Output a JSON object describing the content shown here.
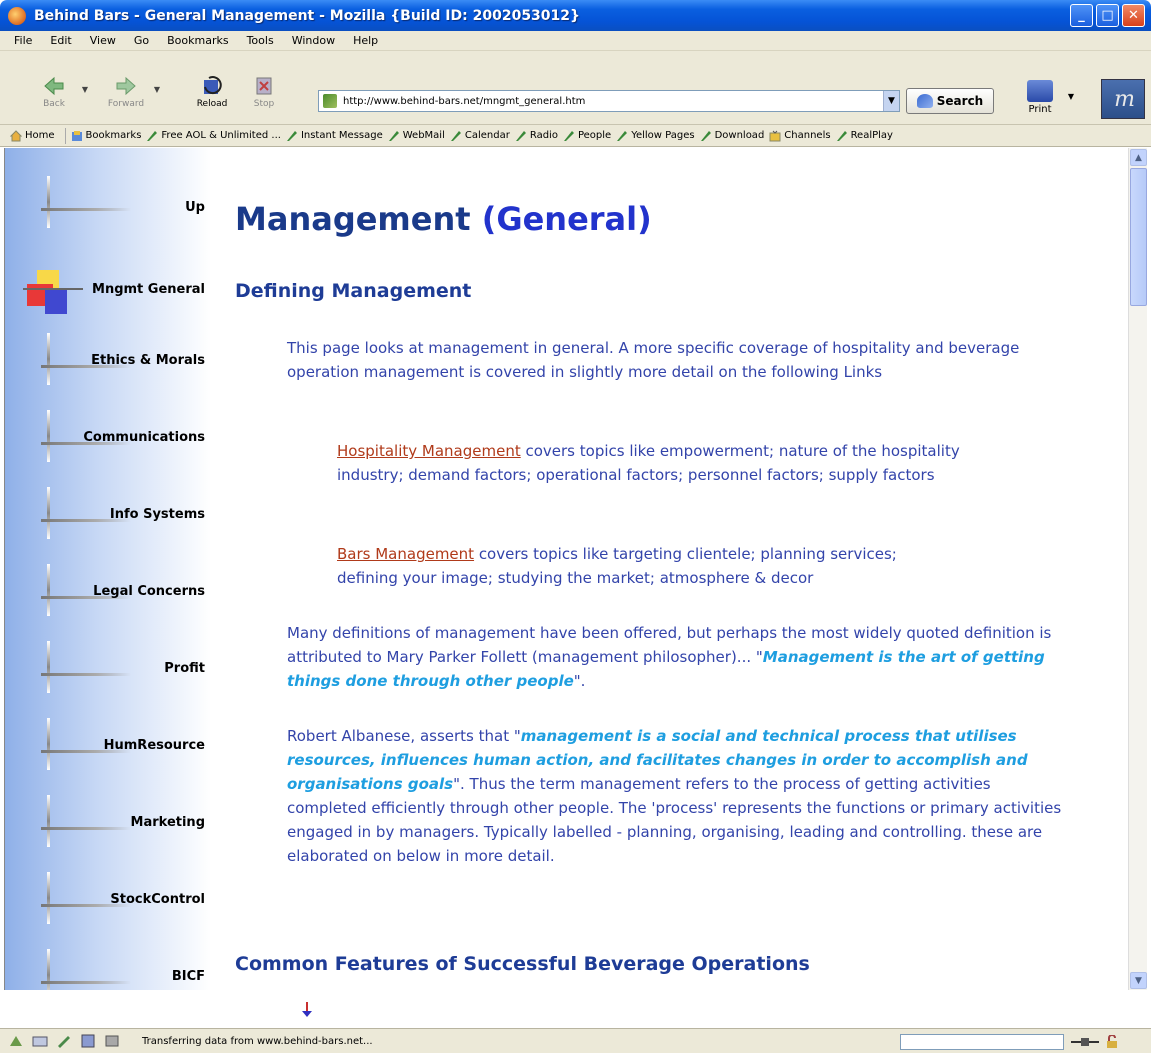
{
  "window": {
    "title": "Behind Bars - General Management - Mozilla {Build ID: 2002053012}"
  },
  "menu": [
    "File",
    "Edit",
    "View",
    "Go",
    "Bookmarks",
    "Tools",
    "Window",
    "Help"
  ],
  "toolbar": {
    "back": "Back",
    "forward": "Forward",
    "reload": "Reload",
    "stop": "Stop",
    "url": "http://www.behind-bars.net/mngmt_general.htm",
    "search": "Search",
    "print": "Print"
  },
  "personal_toolbar": [
    {
      "label": "Home",
      "icon": "home-icon"
    },
    {
      "label": "Bookmarks",
      "icon": "bookmarks-icon"
    },
    {
      "label": "Free AOL & Unlimited ...",
      "icon": "bookmark-link-icon"
    },
    {
      "label": "Instant Message",
      "icon": "bookmark-link-icon"
    },
    {
      "label": "WebMail",
      "icon": "bookmark-link-icon"
    },
    {
      "label": "Calendar",
      "icon": "bookmark-link-icon"
    },
    {
      "label": "Radio",
      "icon": "bookmark-link-icon"
    },
    {
      "label": "People",
      "icon": "bookmark-link-icon"
    },
    {
      "label": "Yellow Pages",
      "icon": "bookmark-link-icon"
    },
    {
      "label": "Download",
      "icon": "bookmark-link-icon"
    },
    {
      "label": "Channels",
      "icon": "channels-icon"
    },
    {
      "label": "RealPlay",
      "icon": "bookmark-link-icon"
    }
  ],
  "sidebar": {
    "items": [
      {
        "label": "Up"
      },
      {
        "label": "Mngmt General",
        "active": true
      },
      {
        "label": "Ethics & Morals"
      },
      {
        "label": "Communications"
      },
      {
        "label": "Info Systems"
      },
      {
        "label": "Legal Concerns"
      },
      {
        "label": "Profit"
      },
      {
        "label": "HumResource"
      },
      {
        "label": "Marketing"
      },
      {
        "label": "StockControl"
      },
      {
        "label": "BICF"
      }
    ]
  },
  "page": {
    "title_main": "Management ",
    "title_paren": "(General)",
    "section1": "Defining Management",
    "intro": "This page looks at management in general. A more specific coverage of hospitality and beverage operation management is covered in slightly more detail on the following Links",
    "link1": "Hospitality Management",
    "link1_desc": " covers topics like empowerment; nature of the hospitality industry; demand factors; operational factors; personnel factors; supply factors",
    "link2": "Bars Management",
    "link2_desc": "  covers topics like targeting clientele; planning services; defining your image; studying the market; atmosphere & decor",
    "p3_text": "Many definitions of management have been offered, but perhaps the most widely quoted definition is attributed to Mary Parker Follett (management philosopher)... \"",
    "p3_quote": "Management is the art of getting things done through other people",
    "p3_end": "\".",
    "p4_start": "Robert Albanese, asserts that \"",
    "p4_quote": "management is a social and technical process that utilises resources, influences human action, and facilitates changes in order to accomplish and organisations goals",
    "p4_end": "\". Thus the term management refers to the process of getting activities completed efficiently through other people. The 'process' represents the functions or primary activities engaged in by managers. Typically labelled - planning, organising, leading and controlling. these are elaborated on below in more detail.",
    "section2": "Common Features of Successful Beverage Operations"
  },
  "status": {
    "text": "Transferring data from www.behind-bars.net..."
  }
}
